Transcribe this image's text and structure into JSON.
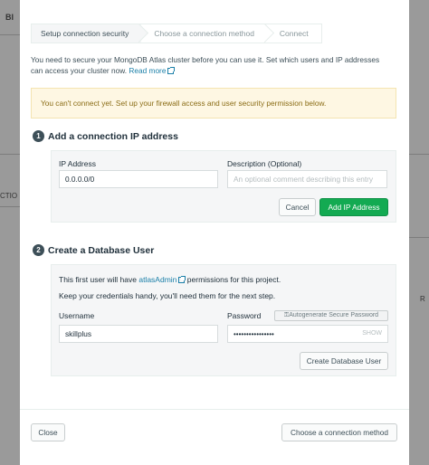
{
  "background": {
    "left_label": "BI",
    "left_label2": "CTIO",
    "right_label": "R"
  },
  "breadcrumb": {
    "steps": [
      "Setup connection security",
      "Choose a connection method",
      "Connect"
    ]
  },
  "intro": {
    "text": "You need to secure your MongoDB Atlas cluster before you can use it. Set which users and IP addresses can access your cluster now.",
    "read_more": "Read more"
  },
  "warning": "You can't connect yet. Set up your firewall access and user security permission below.",
  "step1": {
    "number": "1",
    "title": "Add a connection IP address",
    "ip_label": "IP Address",
    "ip_value": "0.0.0.0/0",
    "desc_label": "Description (Optional)",
    "desc_placeholder": "An optional comment describing this entry",
    "cancel": "Cancel",
    "add": "Add IP Address"
  },
  "step2": {
    "number": "2",
    "title": "Create a Database User",
    "info_prefix": "This first user will have",
    "info_link": "atlasAdmin",
    "info_suffix": "permissions for this project.",
    "info2": "Keep your credentials handy, you'll need them for the next step.",
    "username_label": "Username",
    "username_value": "skillplus",
    "password_label": "Password",
    "autogen": "Autogenerate Secure Password",
    "password_value": "••••••••••••••••",
    "show": "SHOW",
    "create": "Create Database User"
  },
  "footer": {
    "close": "Close",
    "next": "Choose a connection method"
  }
}
